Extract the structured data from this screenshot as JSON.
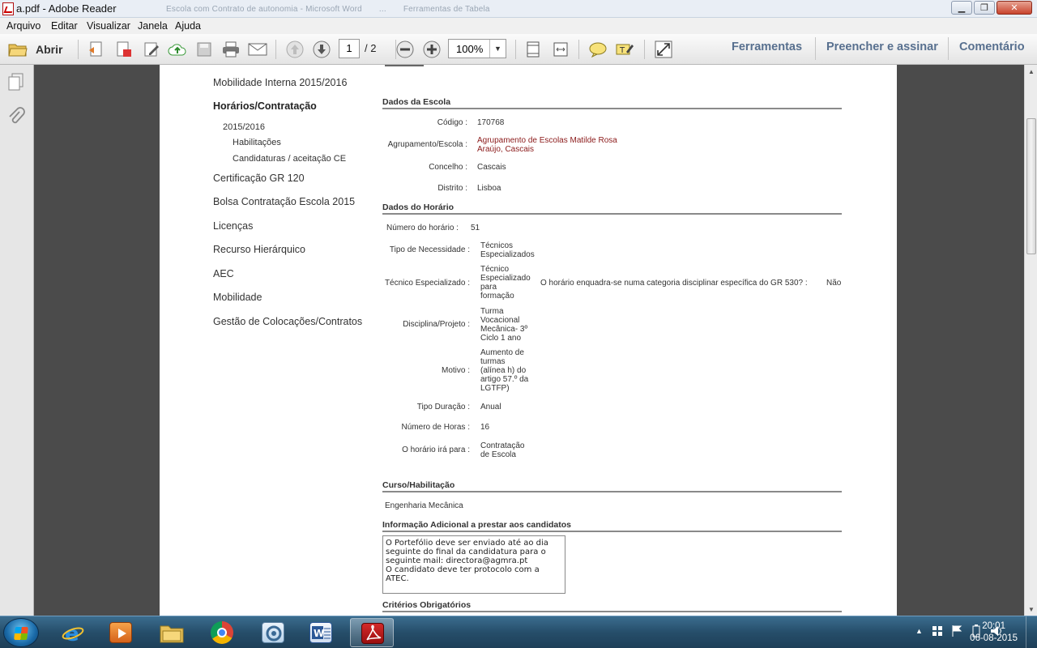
{
  "window": {
    "title": "a.pdf - Adobe Reader",
    "background_titles": [
      "Escola com Contrato de autonomia - Microsoft Word",
      "...",
      "Ferramentas de Tabela"
    ]
  },
  "menu": [
    "Arquivo",
    "Editar",
    "Visualizar",
    "Janela",
    "Ajuda"
  ],
  "toolbar": {
    "open_label": "Abrir",
    "page_current": "1",
    "page_total": "/ 2",
    "zoom": "100%",
    "panels": [
      "Ferramentas",
      "Preencher e assinar",
      "Comentário"
    ]
  },
  "doc_nav": {
    "items": [
      {
        "label": "Mobilidade Interna 2015/2016"
      },
      {
        "label": "Horários/Contratação"
      },
      {
        "label": "2015/2016"
      },
      {
        "label": "Habilitações"
      },
      {
        "label": "Candidaturas / aceitação CE"
      },
      {
        "label": "Certificação GR 120"
      },
      {
        "label": "Bolsa Contratação Escola 2015"
      },
      {
        "label": "Licenças"
      },
      {
        "label": "Recurso Hierárquico"
      },
      {
        "label": "AEC"
      },
      {
        "label": "Mobilidade"
      },
      {
        "label": "Gestão de Colocações/Contratos"
      }
    ]
  },
  "escola": {
    "heading": "Dados da Escola",
    "codigo_label": "Código :",
    "codigo": "170768",
    "agrupamento_label": "Agrupamento/Escola :",
    "agrupamento_line1": "Agrupamento de Escolas Matilde Rosa",
    "agrupamento_line2": "Araújo, Cascais",
    "concelho_label": "Concelho :",
    "concelho": "Cascais",
    "distrito_label": "Distrito :",
    "distrito": "Lisboa"
  },
  "horario": {
    "heading": "Dados do Horário",
    "numero_label": "Número do horário :",
    "numero": "51",
    "tipo_label": "Tipo de Necessidade :",
    "tipo": [
      "Técnicos",
      "Especializados"
    ],
    "tecnico_label": "Técnico Especializado :",
    "tecnico": [
      "Técnico",
      "Especializado",
      "para",
      "formação"
    ],
    "gr530_label": "O horário enquadra-se numa categoria disciplinar específica do GR 530? :",
    "gr530": "Não",
    "disciplina_label": "Disciplina/Projeto :",
    "disciplina": [
      "Turma",
      "Vocacional",
      "Mecânica- 3º",
      "Ciclo 1 ano"
    ],
    "motivo_label": "Motivo :",
    "motivo": [
      "Aumento de",
      "turmas",
      "(alínea h) do",
      "artigo 57.º da",
      "LGTFP)"
    ],
    "duracao_label": "Tipo Duração :",
    "duracao": "Anual",
    "horas_label": "Número de Horas :",
    "horas": "16",
    "para_label": "O horário irá para :",
    "para": [
      "Contratação",
      "de Escola"
    ]
  },
  "curso": {
    "heading": "Curso/Habilitação",
    "value": "Engenharia Mecânica"
  },
  "info": {
    "heading": "Informação Adicional a prestar aos candidatos",
    "text": "O Portefólio deve ser enviado até ao dia\nseguinte do final da candidatura para o\nseguinte mail: directora@agmra.pt\nO candidato deve ter protocolo com a ATEC."
  },
  "criterios": {
    "heading": "Critérios Obrigatórios"
  },
  "taskbar": {
    "time": "20:01",
    "date": "06-08-2015"
  },
  "colors": {
    "accent_panel": "#58708f",
    "red_value": "#8b1a1a",
    "taskbar": "#264e6a"
  }
}
